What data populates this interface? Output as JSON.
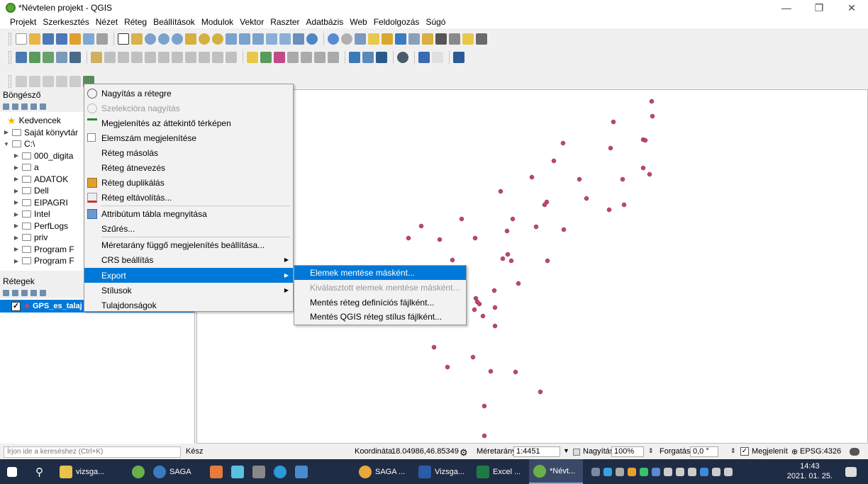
{
  "window": {
    "title": "*Névtelen projekt - QGIS",
    "minimize": "—",
    "restore": "❐",
    "close": "✕"
  },
  "menu": [
    "Projekt",
    "Szerkesztés",
    "Nézet",
    "Réteg",
    "Beállítások",
    "Modulok",
    "Vektor",
    "Raszter",
    "Adatbázis",
    "Web",
    "Feldolgozás",
    "Súgó"
  ],
  "browser": {
    "title": "Böngésző",
    "items": [
      {
        "label": "Kedvencek",
        "icon": "star-icon"
      },
      {
        "label": "Saját könyvtár",
        "icon": "home-icon"
      },
      {
        "label": "C:\\",
        "icon": "drive-icon"
      },
      {
        "label": "000_digita",
        "icon": "folder-icon"
      },
      {
        "label": "a",
        "icon": "folder-icon"
      },
      {
        "label": "ADATOK",
        "icon": "folder-icon"
      },
      {
        "label": "Dell",
        "icon": "folder-icon"
      },
      {
        "label": "EIPAGRI",
        "icon": "folder-icon"
      },
      {
        "label": "Intel",
        "icon": "folder-icon"
      },
      {
        "label": "PerfLogs",
        "icon": "folder-icon"
      },
      {
        "label": "priv",
        "icon": "folder-icon"
      },
      {
        "label": "Program F",
        "icon": "folder-icon"
      },
      {
        "label": "Program F",
        "icon": "folder-icon"
      }
    ]
  },
  "layers": {
    "title": "Rétegek",
    "layer_name": "GPS_es_talaj"
  },
  "context_menu": {
    "items": [
      "Nagyítás a rétegre",
      "Szelekcióra nagyítás",
      "Megjelenítés az áttekintő térképen",
      "Elemszám megjelenítése",
      "Réteg másolás",
      "Réteg átnevezés",
      "Réteg duplikálás",
      "Réteg eltávolítás...",
      "Attribútum tábla megnyitása",
      "Szűrés...",
      "Méretarány függő megjelenítés beállítása...",
      "CRS beállítás",
      "Export",
      "Stílusok",
      "Tulajdonságok"
    ]
  },
  "export_submenu": {
    "items": [
      "Elemek mentése másként...",
      "Kiválasztott elemek mentése másként...",
      "Mentés réteg definíciós fájlként...",
      "Mentés QGIS réteg stílus fájlként..."
    ]
  },
  "status": {
    "search_placeholder": "Írjon ide a kereséshez (Ctrl+K)",
    "ready": "Kész",
    "coord_label": "Koordináta",
    "coord_value": "18.04986,46.85349",
    "scale_label": "Méretarány",
    "scale_value": "1:4451",
    "zoom_label": "Nagyítás",
    "zoom_value": "100%",
    "rotation_label": "Forgatás",
    "rotation_value": "0,0 °",
    "render_label": "Megjelenít",
    "crs": "EPSG:4326"
  },
  "taskbar": {
    "items": [
      "vizsga...",
      "SAGA",
      "SAGA ...",
      "Vizsga...",
      "Excel ...",
      "*Névt..."
    ],
    "time": "14:43",
    "date": "2021. 01. 25."
  },
  "colors": {
    "point": "#c2466d",
    "selection": "#0078d7",
    "taskbar": "#1f2c45"
  }
}
